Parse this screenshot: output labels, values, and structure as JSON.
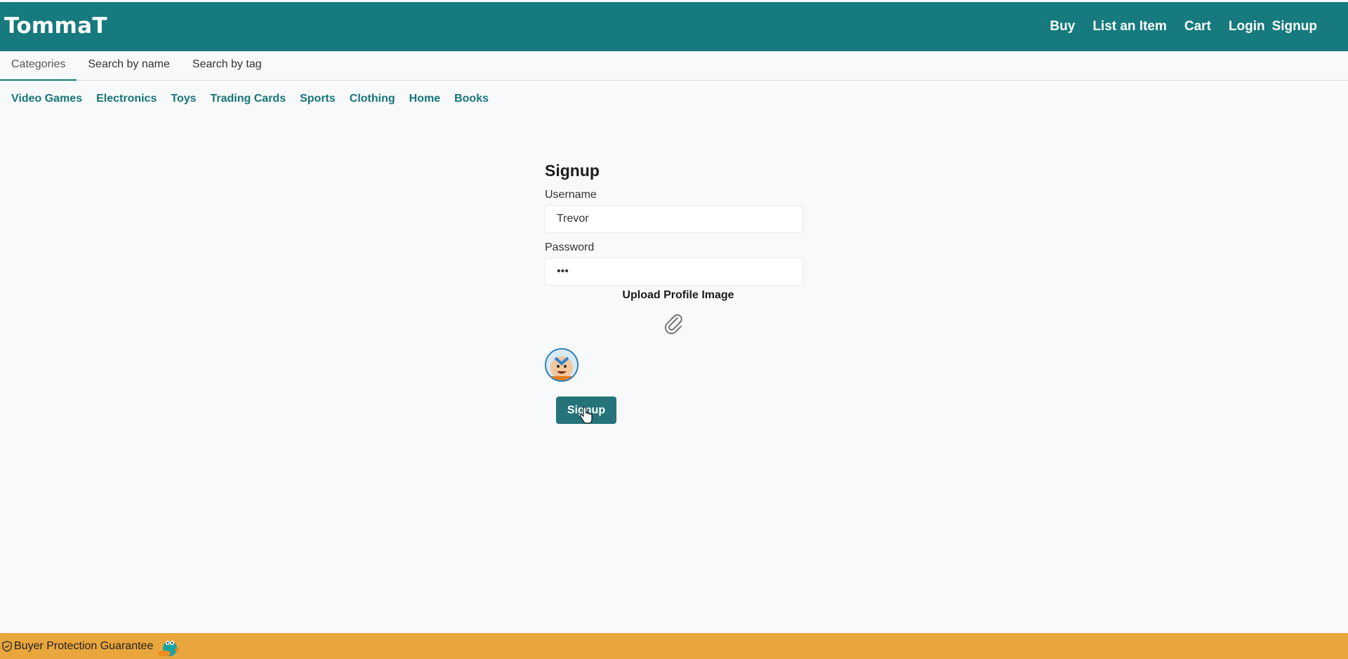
{
  "header": {
    "brand": "TommaT",
    "nav": {
      "buy": "Buy",
      "list_item": "List an Item",
      "cart": "Cart",
      "login": "Login",
      "signup": "Signup"
    }
  },
  "tabs": [
    "Categories",
    "Search by name",
    "Search by tag"
  ],
  "categories": [
    "Video Games",
    "Electronics",
    "Toys",
    "Trading Cards",
    "Sports",
    "Clothing",
    "Home",
    "Books"
  ],
  "form": {
    "title": "Signup",
    "username_label": "Username",
    "username_value": "Trevor",
    "password_label": "Password",
    "password_value": "•••",
    "upload_label": "Upload Profile Image",
    "submit_label": "Signup"
  },
  "footer": {
    "guarantee": "Buyer Protection Guarantee"
  },
  "colors": {
    "primary": "#167a7e",
    "footer": "#e9a63d",
    "link": "#177478"
  },
  "icons": [
    "paperclip-icon",
    "shield-icon",
    "pointer-cursor-icon"
  ]
}
